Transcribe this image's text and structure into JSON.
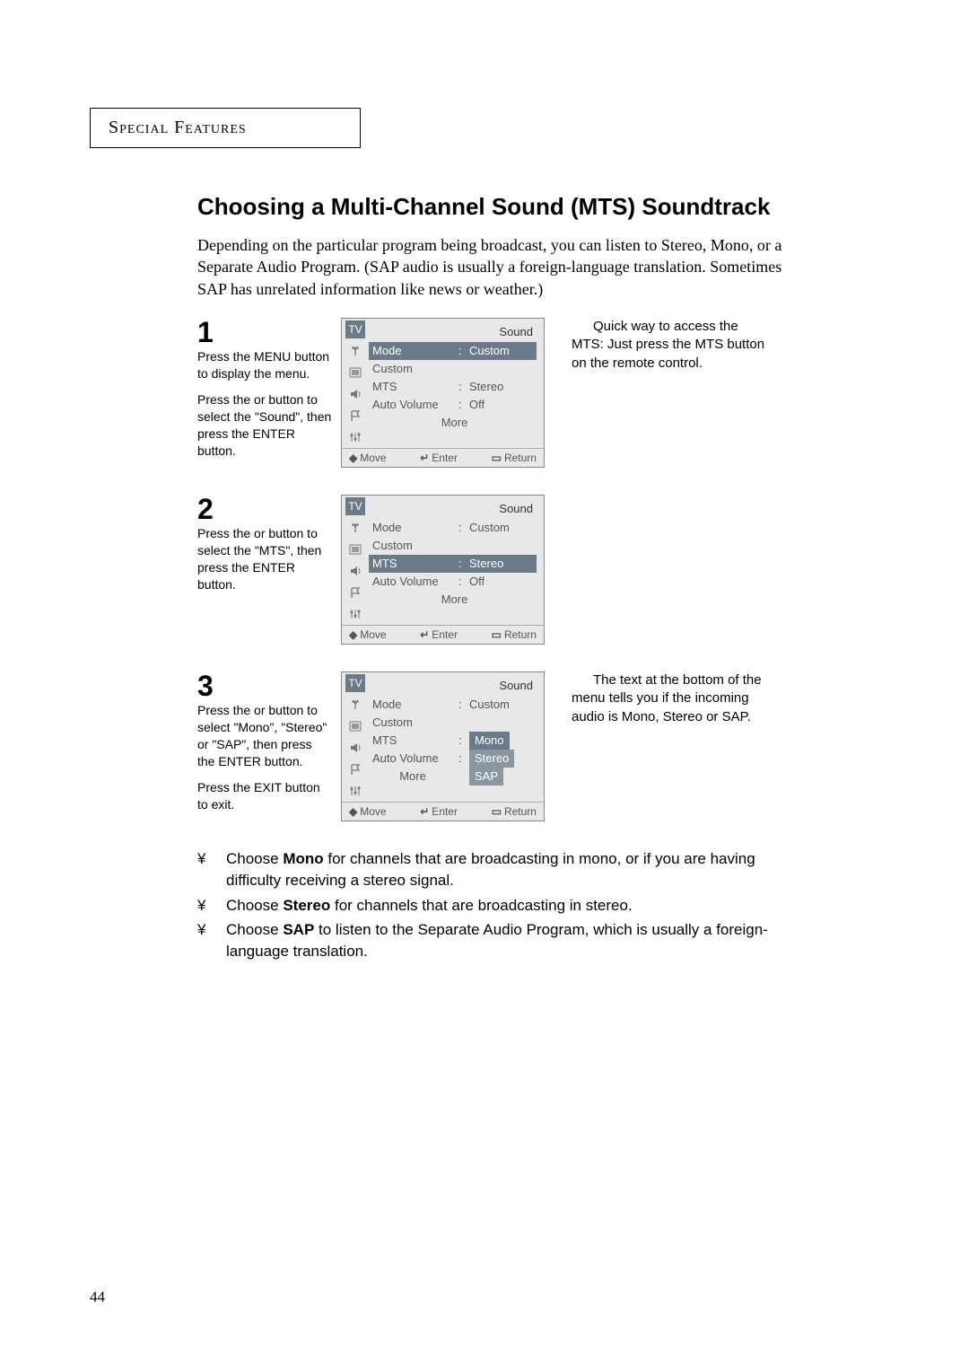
{
  "section_header": "Special Features",
  "title": "Choosing a Multi-Channel Sound (MTS) Soundtrack",
  "intro": "Depending on the particular program being broadcast, you can listen to Stereo, Mono, or a Separate Audio Program. (SAP audio is usually a foreign-language translation. Sometimes SAP has unrelated information like news or weather.)",
  "side_notes": {
    "quick": "Quick way to access the MTS: Just press the  MTS  button on the remote control.",
    "bottom": "The text at the bottom of the menu tells you if the incoming audio is Mono, Stereo or SAP."
  },
  "steps": [
    {
      "num": "1",
      "text_parts": [
        "Press the MENU button to display the menu.",
        "Press the    or    button to select the \"Sound\", then press the ENTER button."
      ],
      "osd": {
        "title": "Sound",
        "tv": "TV",
        "hl_row": 0,
        "rows": [
          {
            "label": "Mode",
            "val": "Custom"
          },
          {
            "label": "Custom",
            "val": ""
          },
          {
            "label": "MTS",
            "val": "Stereo"
          },
          {
            "label": "Auto Volume",
            "val": "Off"
          }
        ],
        "more": "More",
        "footer": {
          "move": "Move",
          "enter": "Enter",
          "return": "Return"
        }
      }
    },
    {
      "num": "2",
      "text_parts": [
        "Press the    or    button to select the \"MTS\", then press the ENTER button."
      ],
      "osd": {
        "title": "Sound",
        "tv": "TV",
        "hl_row": 2,
        "rows": [
          {
            "label": "Mode",
            "val": "Custom"
          },
          {
            "label": "Custom",
            "val": ""
          },
          {
            "label": "MTS",
            "val": "Stereo"
          }
        ],
        "extra_rows": [
          {
            "label": "Auto Volume",
            "val": "Off"
          }
        ],
        "more": "More",
        "footer": {
          "move": "Move",
          "enter": "Enter",
          "return": "Return"
        }
      }
    },
    {
      "num": "3",
      "text_parts": [
        "Press the    or    button to select \"Mono\", \"Stereo\" or \"SAP\", then press the ENTER button.",
        "Press the EXIT button to exit."
      ],
      "osd": {
        "title": "Sound",
        "tv": "TV",
        "hl_row": -1,
        "rows": [
          {
            "label": "Mode",
            "val": "Custom"
          },
          {
            "label": "Custom",
            "val": ""
          },
          {
            "label": "MTS",
            "val": ""
          }
        ],
        "sub_options": [
          "Mono",
          "Stereo",
          "SAP"
        ],
        "sub_hl": 0,
        "av_label": "Auto Volume",
        "more": "More",
        "footer": {
          "move": "Move",
          "enter": "Enter",
          "return": "Return"
        }
      }
    }
  ],
  "bullets": [
    {
      "prefix": "Choose ",
      "bold": "Mono",
      "rest": " for channels that are broadcasting in mono, or if you are having difficulty receiving a stereo signal."
    },
    {
      "prefix": "Choose ",
      "bold": "Stereo",
      "rest": " for channels that are broadcasting in stereo."
    },
    {
      "prefix": "Choose ",
      "bold": "SAP",
      "rest": " to listen to the Separate Audio Program, which is usually a foreign-language translation."
    }
  ],
  "bullet_mark": "¥",
  "page_number": "44",
  "icons": {
    "tv": "TV",
    "move_glyph": "◆",
    "enter_glyph": "↵",
    "return_glyph": "▭"
  }
}
